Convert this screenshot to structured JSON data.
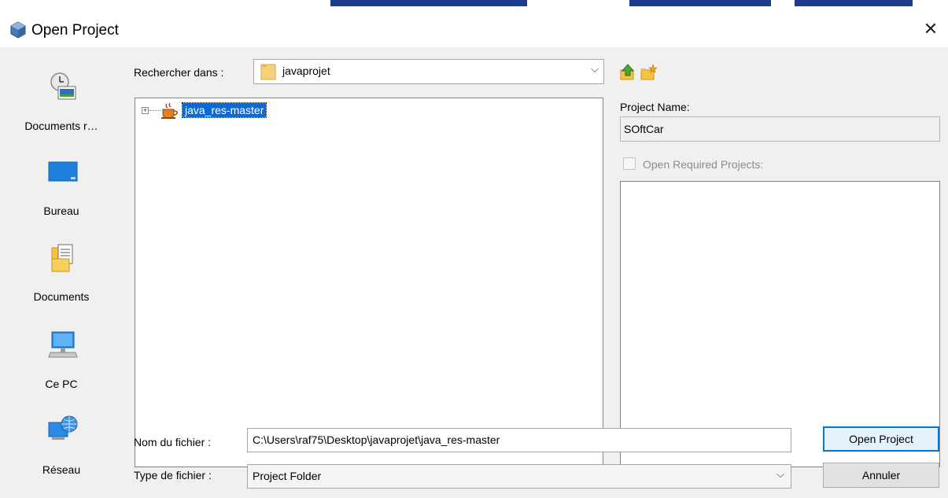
{
  "window": {
    "title": "Open Project",
    "close_glyph": "✕",
    "icon": "netbeans-cube-icon"
  },
  "places": [
    {
      "label": "Documents r…",
      "icon": "recent-documents-icon"
    },
    {
      "label": "Bureau",
      "icon": "desktop-icon"
    },
    {
      "label": "Documents",
      "icon": "documents-folder-icon"
    },
    {
      "label": "Ce PC",
      "icon": "computer-icon"
    },
    {
      "label": "Réseau",
      "icon": "network-icon"
    }
  ],
  "look_in": {
    "label": "Rechercher dans :",
    "value": "javaprojet",
    "arrow": "⌵"
  },
  "toolbar": {
    "up_icon": "up-folder-icon",
    "new_icon": "new-folder-icon"
  },
  "file_list": {
    "items": [
      {
        "label": "java_res-master",
        "icon": "java-project-cup-icon",
        "expander": "+"
      }
    ]
  },
  "project": {
    "name_label": "Project Name:",
    "name_value": "SOftCar",
    "required_label": "Open Required Projects:",
    "required_checked": false
  },
  "filename": {
    "label": "Nom du fichier :",
    "value": "C:\\Users\\raf75\\Desktop\\javaprojet\\java_res-master"
  },
  "filetype": {
    "label": "Type de fichier :",
    "value": "Project Folder",
    "arrow": "⌵"
  },
  "buttons": {
    "open": "Open Project",
    "cancel": "Annuler"
  },
  "colors": {
    "selection": "#0a6ad6",
    "dialog_bg": "#f0f0f0",
    "default_button_border": "#0078d7"
  }
}
